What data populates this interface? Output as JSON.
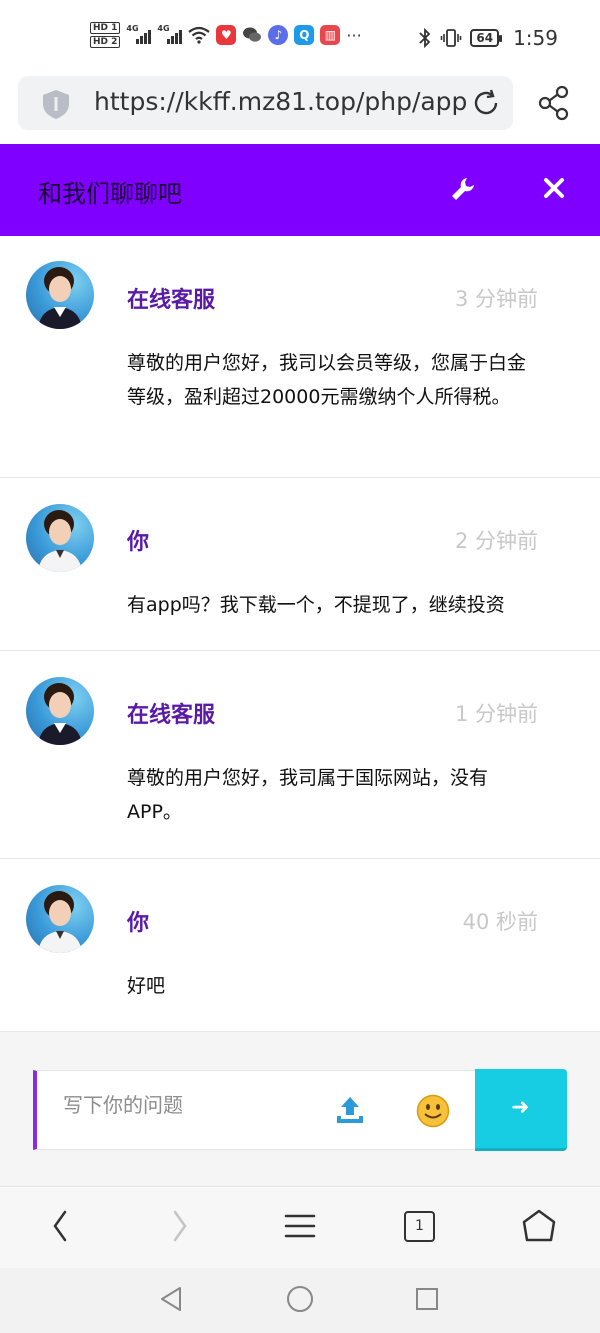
{
  "status_bar": {
    "hd1": "HD 1",
    "hd2": "HD 2",
    "signal1": "4G",
    "signal2": "4G",
    "more": "···",
    "battery": "64",
    "time": "1:59"
  },
  "browser": {
    "url": "https://kkff.mz81.top/php/app",
    "tab_count": "1"
  },
  "header": {
    "title": "和我们聊聊吧",
    "background_color": "#8000ff"
  },
  "messages": [
    {
      "sender": "在线客服",
      "time": "3 分钟前",
      "text": "尊敬的用户您好，我司以会员等级，您属于白金等级，盈利超过20000元需缴纳个人所得税。"
    },
    {
      "sender": "你",
      "time": "2 分钟前",
      "text": "有app吗？我下载一个，不提现了，继续投资"
    },
    {
      "sender": "在线客服",
      "time": "1 分钟前",
      "text": "尊敬的用户您好，我司属于国际网站，没有APP。"
    },
    {
      "sender": "你",
      "time": "40 秒前",
      "text": "好吧"
    }
  ],
  "composer": {
    "placeholder": "写下你的问题",
    "send_icon": "arrow-right-icon",
    "upload_icon": "upload-icon",
    "emoji_icon": "smiley-icon",
    "accent_color": "#17cde3"
  }
}
